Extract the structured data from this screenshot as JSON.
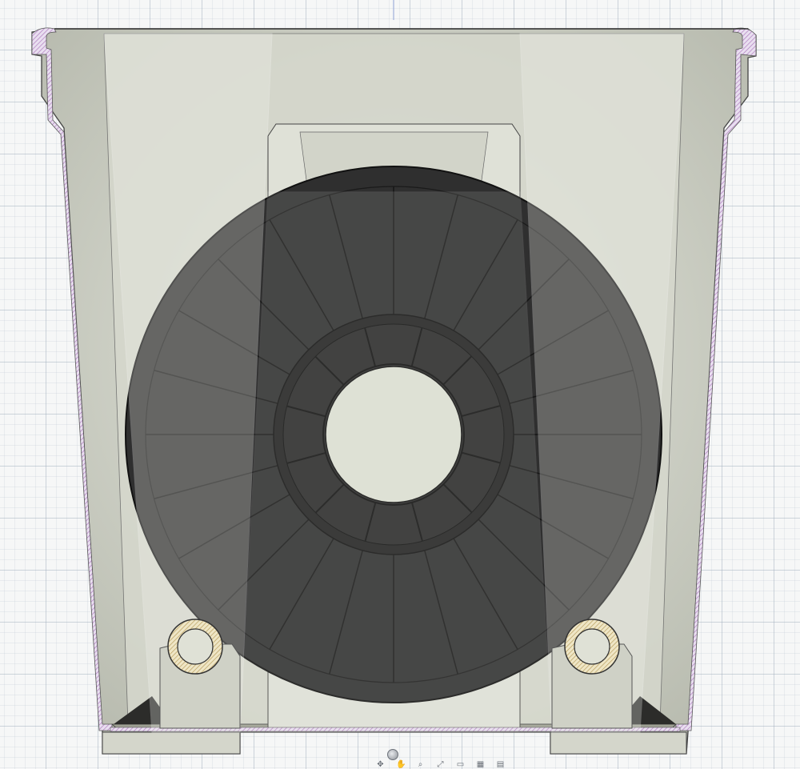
{
  "viewport": {
    "background": "#f6f7f7",
    "grid_color": "#b4bec8",
    "axis_color": "#8fa2d6"
  },
  "model": {
    "description_icon": "filament-spool-in-dry-box-section-view",
    "housing_color": "#d9dbd1",
    "section_hatch_color": "#c3a2c9",
    "spool_color": "#2e2e2e",
    "hub_color": "#dcdfd3",
    "bearing_color": "#e8dcb8"
  },
  "nav_toolbar": {
    "items": [
      {
        "icon": "orbit-icon",
        "glyph": "✥"
      },
      {
        "icon": "pan-icon",
        "glyph": "✋"
      },
      {
        "icon": "zoom-icon",
        "glyph": "⌕"
      },
      {
        "icon": "fit-icon",
        "glyph": "⤢"
      },
      {
        "icon": "display-settings-icon",
        "glyph": "▭"
      },
      {
        "icon": "grid-settings-icon",
        "glyph": "▦"
      },
      {
        "icon": "viewports-icon",
        "glyph": "▤"
      }
    ]
  }
}
